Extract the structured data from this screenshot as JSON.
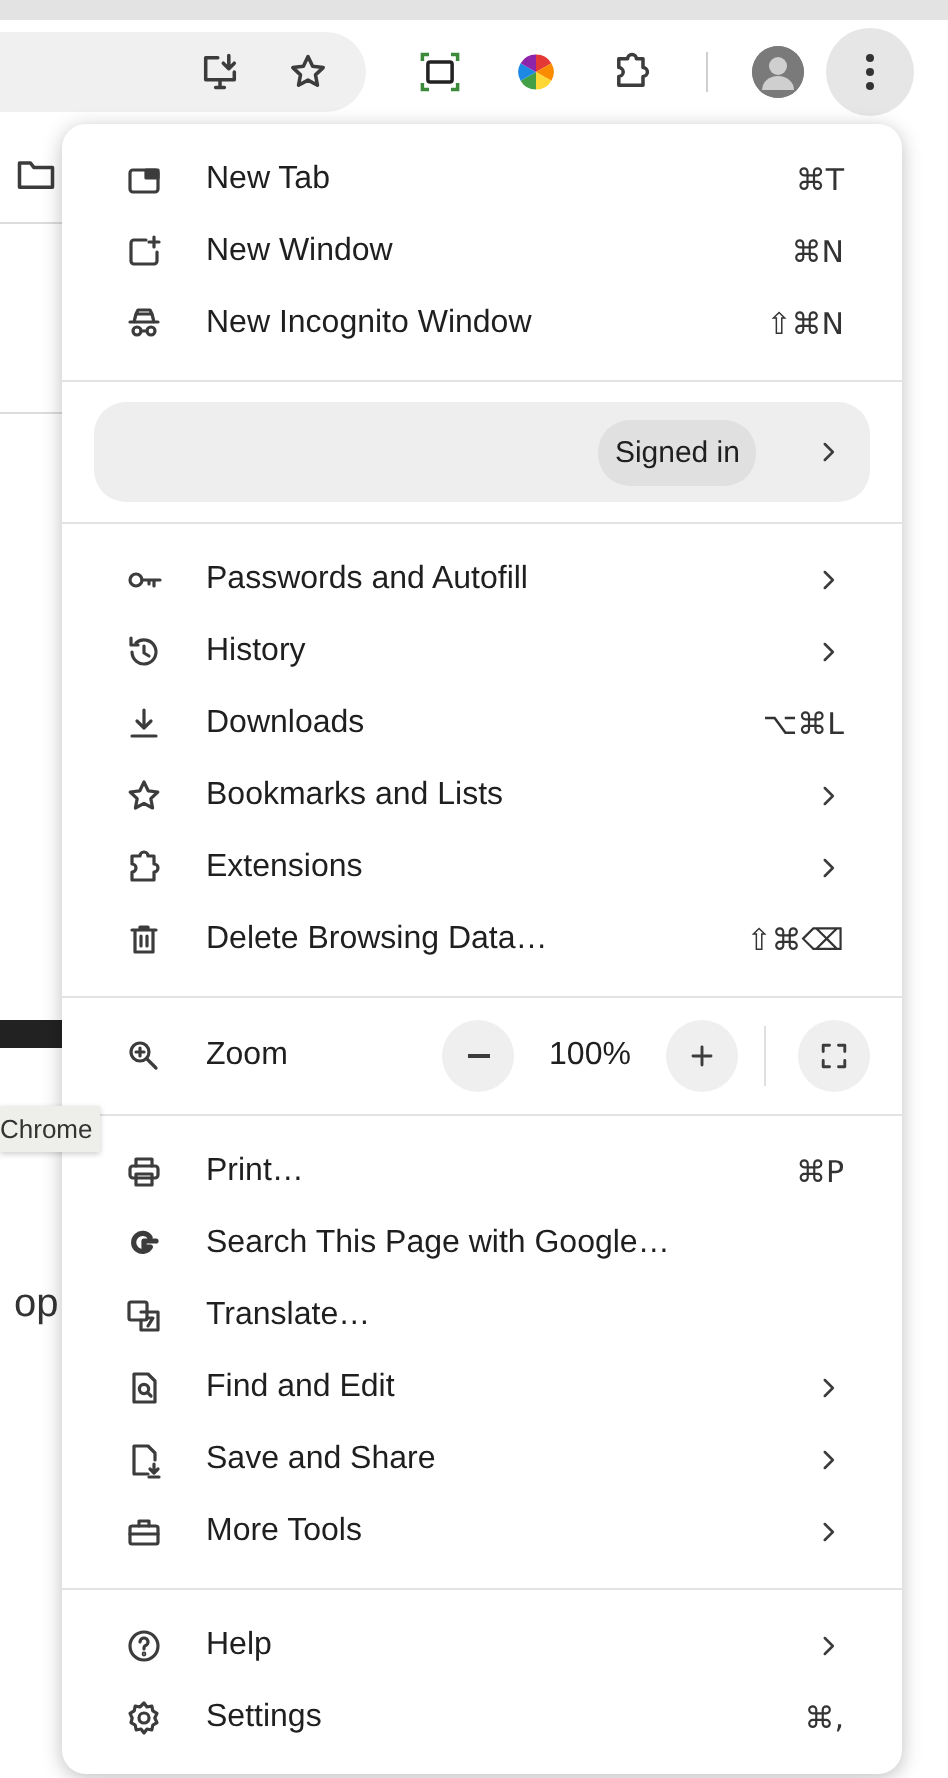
{
  "page": {
    "tooltip": "Chrome",
    "text_fragment": "op"
  },
  "menu": {
    "groups": [
      {
        "kind": "items",
        "items": [
          {
            "label": "New Tab",
            "kind": "shortcut",
            "shortcut": "⌘T"
          },
          {
            "label": "New Window",
            "kind": "shortcut",
            "shortcut": "⌘N"
          },
          {
            "label": "New Incognito Window",
            "kind": "shortcut",
            "shortcut": "⇧⌘N"
          }
        ]
      },
      {
        "kind": "profile",
        "badge": "Signed in"
      },
      {
        "kind": "items",
        "items": [
          {
            "label": "Passwords and Autofill",
            "kind": "submenu"
          },
          {
            "label": "History",
            "kind": "submenu"
          },
          {
            "label": "Downloads",
            "kind": "shortcut",
            "shortcut": "⌥⌘L"
          },
          {
            "label": "Bookmarks and Lists",
            "kind": "submenu"
          },
          {
            "label": "Extensions",
            "kind": "submenu"
          },
          {
            "label": "Delete Browsing Data…",
            "kind": "shortcut",
            "shortcut": "⇧⌘⌫"
          }
        ]
      },
      {
        "kind": "zoom",
        "label": "Zoom",
        "value": "100%"
      },
      {
        "kind": "items",
        "items": [
          {
            "label": "Print…",
            "kind": "shortcut",
            "shortcut": "⌘P"
          },
          {
            "label": "Search This Page with Google…",
            "kind": "plain"
          },
          {
            "label": "Translate…",
            "kind": "plain"
          },
          {
            "label": "Find and Edit",
            "kind": "submenu"
          },
          {
            "label": "Save and Share",
            "kind": "submenu"
          },
          {
            "label": "More Tools",
            "kind": "submenu"
          }
        ]
      },
      {
        "kind": "items",
        "items": [
          {
            "label": "Help",
            "kind": "submenu"
          },
          {
            "label": "Settings",
            "kind": "shortcut",
            "shortcut": "⌘,"
          }
        ]
      }
    ]
  }
}
